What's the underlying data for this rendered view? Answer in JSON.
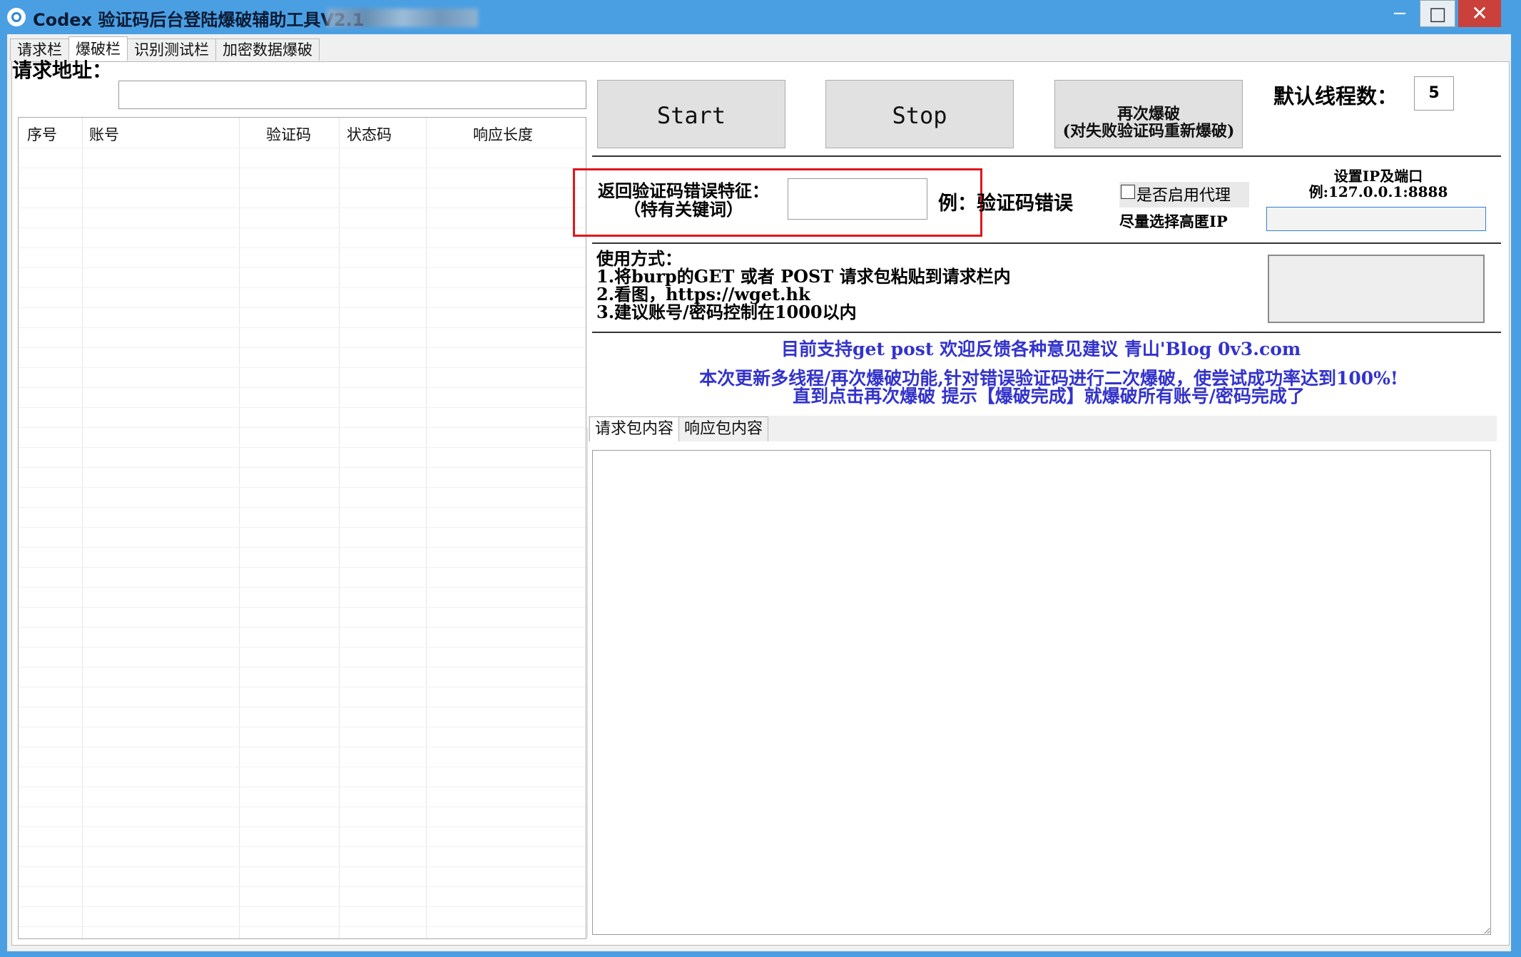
{
  "window": {
    "title": "Codex 验证码后台登陆爆破辅助工具V2.1",
    "controls": {
      "minimize": "−",
      "maximize": "□",
      "close": "✕"
    }
  },
  "tabs": [
    {
      "label": "请求栏",
      "active": false
    },
    {
      "label": "爆破栏",
      "active": true
    },
    {
      "label": "识别测试栏",
      "active": false
    },
    {
      "label": "加密数据爆破",
      "active": false
    }
  ],
  "request": {
    "url_label": "请求地址：",
    "url_value": ""
  },
  "grid": {
    "columns": [
      "序号",
      "账号",
      "验证码",
      "状态码",
      "响应长度"
    ],
    "rows": []
  },
  "buttons": {
    "start": "Start",
    "stop": "Stop",
    "again_line1": "再次爆破",
    "again_line2": "(对失败验证码重新爆破)"
  },
  "threads": {
    "label": "默认线程数：",
    "value": "5"
  },
  "error_feature": {
    "label_line1": "返回验证码错误特征：",
    "label_line2": "（特有关键词）",
    "value": "",
    "example": "例：验证码错误"
  },
  "proxy": {
    "checkbox_label": "是否启用代理",
    "checked": false,
    "hint": "尽量选择高匿IP",
    "ip_label_line1": "设置IP及端口",
    "ip_label_line2": "例:127.0.0.1:8888",
    "ip_value": ""
  },
  "usage": {
    "title": "使用方式：",
    "lines": [
      "1.将burp的GET 或者 POST 请求包粘贴到请求栏内",
      "2.看图，https://wget.hk",
      "3.建议账号/密码控制在1000以内"
    ]
  },
  "notice": {
    "support": "目前支持get post 欢迎反馈各种意见建议 青山'Blog 0v3.com",
    "update_line1": "本次更新多线程/再次爆破功能,针对错误验证码进行二次爆破，使尝试成功率达到100%!",
    "update_line2": "直到点击再次爆破 提示【爆破完成】就爆破所有账号/密码完成了"
  },
  "packet_tabs": [
    {
      "label": "请求包内容",
      "active": true
    },
    {
      "label": "响应包内容",
      "active": false
    }
  ],
  "colors": {
    "titlebar": "#4a9fe3",
    "close": "#c9413a",
    "highlight": "#e0161b",
    "notice_text": "#3333cc"
  }
}
